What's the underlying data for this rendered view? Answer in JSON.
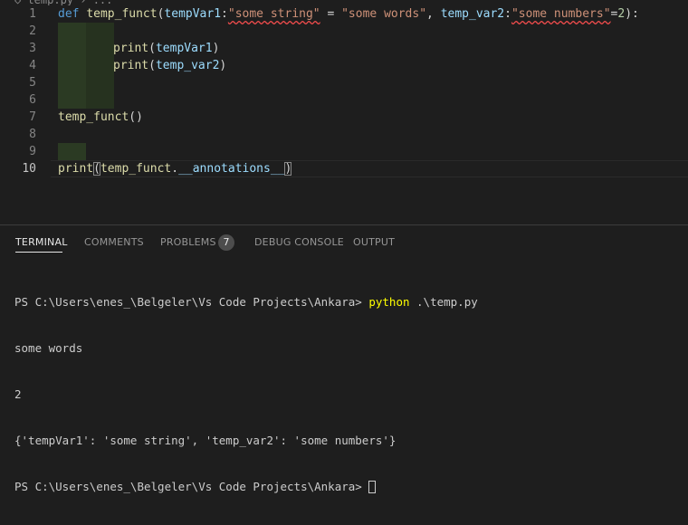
{
  "editor": {
    "line_numbers": [
      "1",
      "2",
      "3",
      "4",
      "5",
      "6",
      "7",
      "8",
      "9",
      "10"
    ],
    "line1": {
      "def": "def",
      "name": "temp_funct",
      "open": "(",
      "p1": "tempVar1",
      "p1_colon": ":",
      "p1_annot": "\"some string\"",
      "eq1": " = ",
      "p1_default": "\"some words\"",
      "comma": ", ",
      "p2": "temp_var2",
      "p2_colon": ":",
      "p2_annot": "\"some numbers\"",
      "eq2": "=",
      "p2_default": "2",
      "close": "):"
    },
    "line3": {
      "fn": "print",
      "open": "(",
      "arg": "tempVar1",
      "close": ")"
    },
    "line4": {
      "fn": "print",
      "open": "(",
      "arg": "temp_var2",
      "close": ")"
    },
    "line7": {
      "fn": "temp_funct",
      "parens": "()"
    },
    "line10": {
      "fn": "print",
      "open": "(",
      "obj": "temp_funct",
      "dot": ".",
      "attr": "__annotations__",
      "close": ")"
    }
  },
  "panel": {
    "tabs": {
      "terminal": "TERMINAL",
      "comments": "COMMENTS",
      "problems": "PROBLEMS",
      "problems_count": "7",
      "debug_console": "DEBUG CONSOLE",
      "output": "OUTPUT"
    },
    "terminal": {
      "prompt1": "PS C:\\Users\\enes_\\Belgeler\\Vs Code Projects\\Ankara> ",
      "cmd1": "python",
      "cmd1_args": " .\\temp.py",
      "out1": "some words",
      "out2": "2",
      "out3": "{'tempVar1': 'some string', 'temp_var2': 'some numbers'}",
      "prompt2": "PS C:\\Users\\enes_\\Belgeler\\Vs Code Projects\\Ankara> "
    }
  },
  "colors": {
    "background": "#1e1e1e",
    "keyword": "#569cd6",
    "function": "#dcdcaa",
    "variable": "#9cdcfe",
    "string": "#ce9178",
    "number": "#b5cea8",
    "error_squiggle": "#f14c4c",
    "terminal_command": "#ffff00"
  }
}
